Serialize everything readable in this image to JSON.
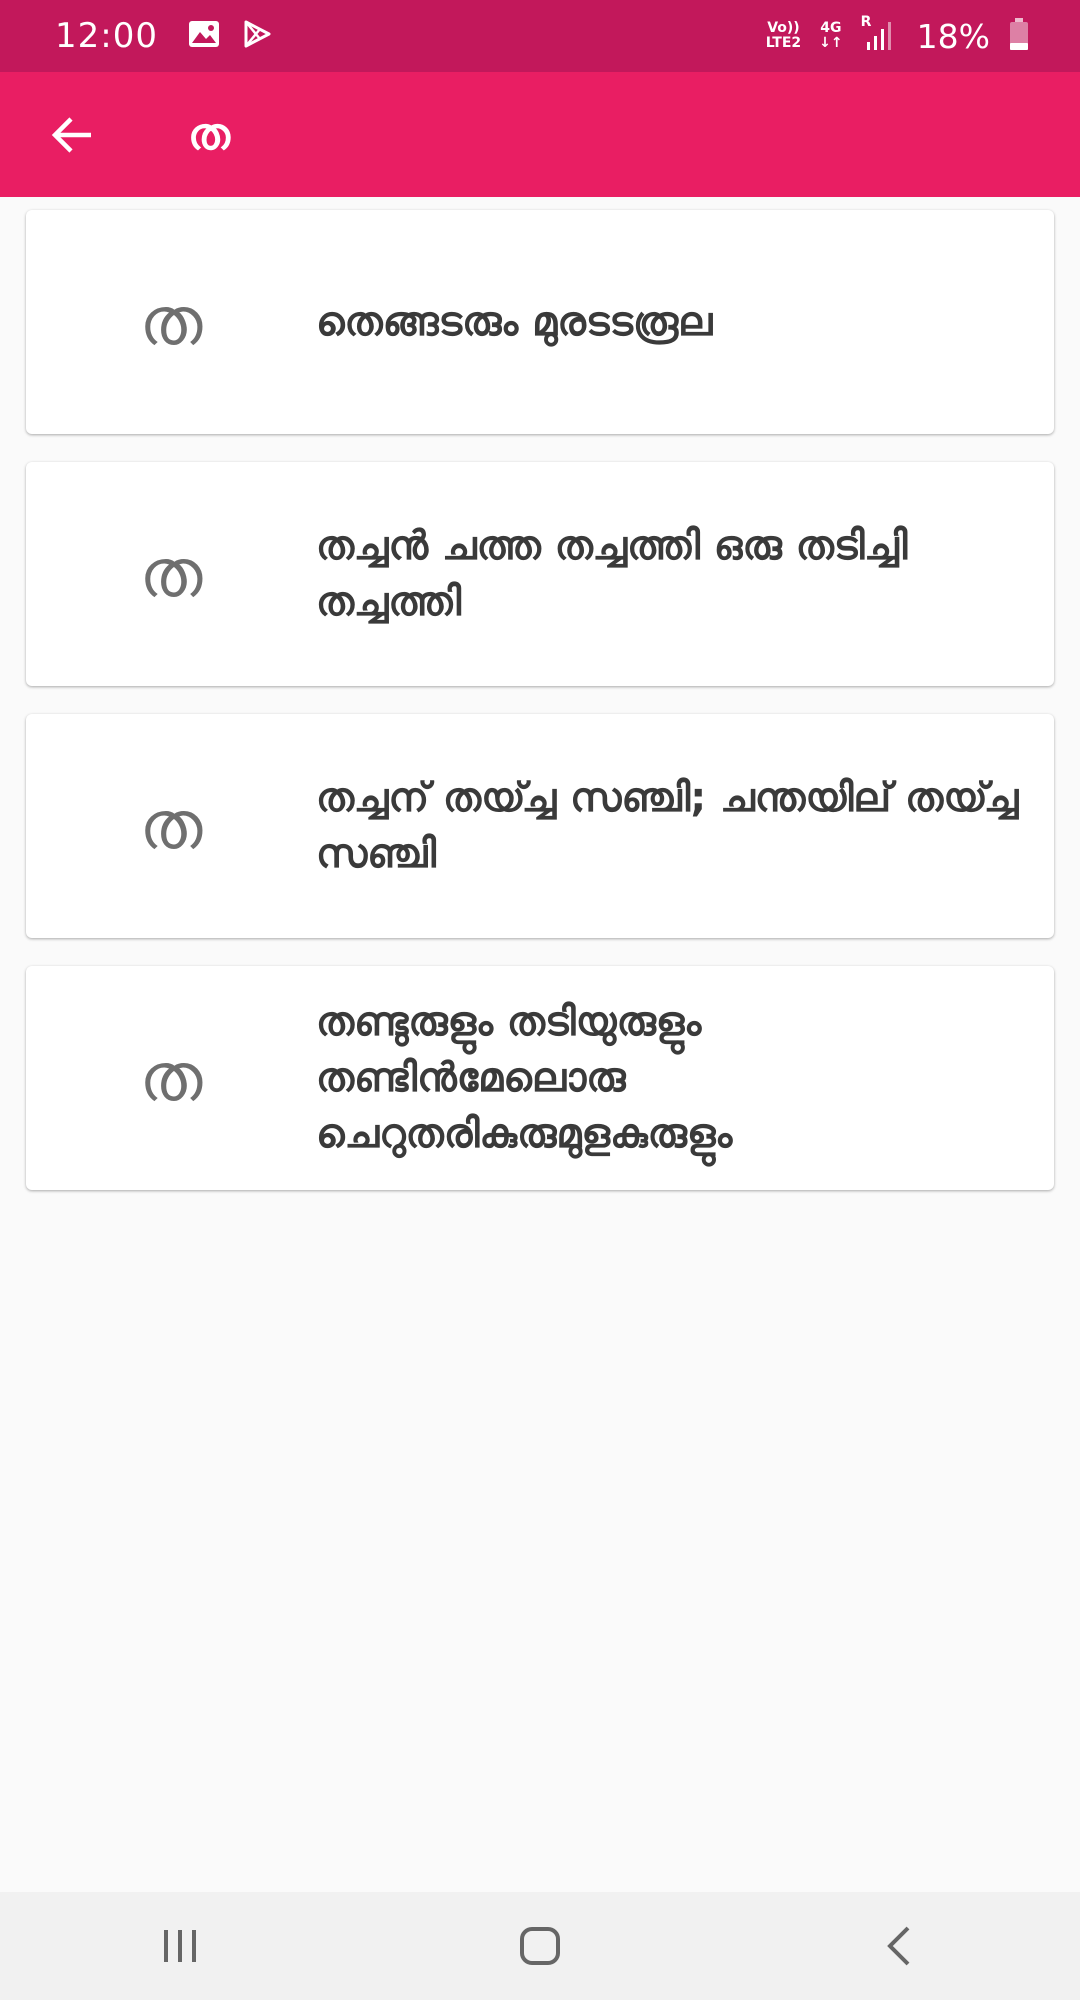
{
  "status_bar": {
    "time": "12:00",
    "network_top": "Vo))",
    "network_bottom": "LTE2",
    "net_type": "4G",
    "roaming": "R",
    "battery": "18%",
    "icons": [
      "image-icon",
      "play-store-icon",
      "signal-icon",
      "battery-icon"
    ]
  },
  "app_bar": {
    "title": "ത",
    "back_icon": "arrow-left-icon"
  },
  "cards": [
    {
      "letter": "ത",
      "text": "തെങ്ങടരും മുരടടരൂല"
    },
    {
      "letter": "ത",
      "text": "തച്ചൻ ചത്ത തച്ചത്തി ഒരു തടിച്ചി തച്ചത്തി"
    },
    {
      "letter": "ത",
      "text": "തച്ചന് തയ്ച്ച സഞ്ചി; ചന്തയില് തയ്ച്ച സഞ്ചി"
    },
    {
      "letter": "ത",
      "text": "തണ്ടുരുളും തടിയുരുളും തണ്ടിൻമേലൊരു ചെറുതരികുരുമുളകുരുളും"
    }
  ],
  "nav_bar": {
    "icons": [
      "recent-apps-icon",
      "home-icon",
      "back-icon"
    ]
  },
  "colors": {
    "status_bar": "#c2185b",
    "app_bar": "#e91e63",
    "background": "#fafafa"
  }
}
